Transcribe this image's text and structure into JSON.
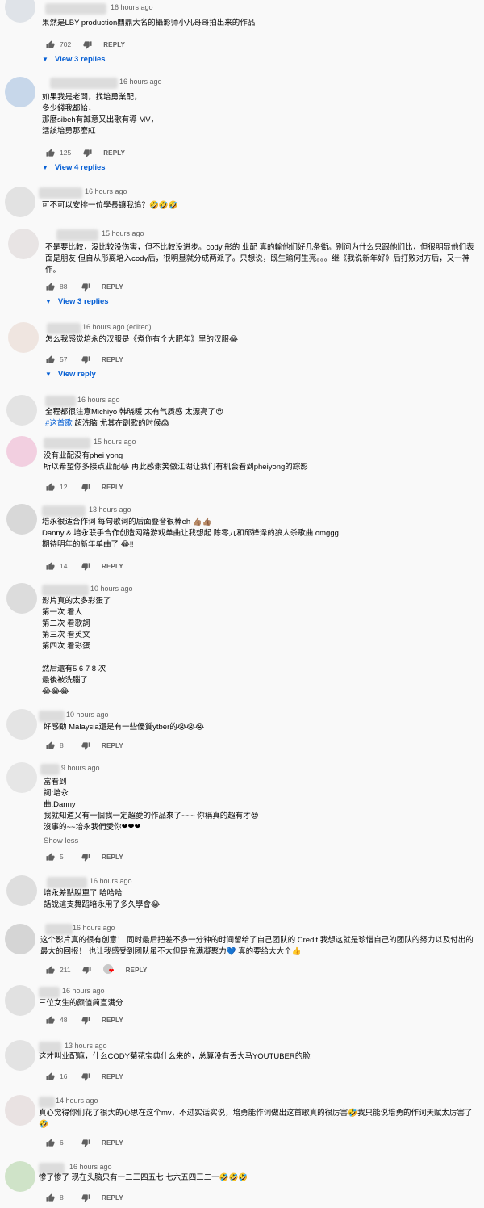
{
  "ui": {
    "reply_label": "REPLY",
    "like_icon": "thumbs-up-icon",
    "dislike_icon": "thumbs-down-icon",
    "expand_icon": "caret-down-icon"
  },
  "comments": [
    {
      "time": "16 hours ago",
      "lines": [
        "果然是LBY production鼎鼎大名的攝影师小凡哥哥拍出来的作品"
      ],
      "likes": "702",
      "replies_label": "View 3 replies",
      "avatar_color": "#dfe3e8"
    },
    {
      "time": "16 hours ago",
      "lines": [
        "如果我是老闆，找培勇業配，",
        "多少錢我都給，",
        "那麼sibeh有誠意又出歌有導 MV，",
        "活該培勇那麼紅"
      ],
      "likes": "125",
      "replies_label": "View 4 replies",
      "avatar_color": "#c7d7ea"
    },
    {
      "time": "16 hours ago",
      "lines": [
        "可不可以安排一位學長讓我追？🤣🤣🤣"
      ],
      "avatar_color": "#e2e2e2"
    },
    {
      "time": "15 hours ago",
      "lines": [
        "不是要比較，没比较没伤害，但不比較没进步。cody 彤的 业配 真的輸他们好几条街。别问为什么只跟他们比，但很明显他们表面是朋友 但自从彤离培入cody后，很明显就分成两派了。只想说，既生瑜何生亮。。。继《我说新年好》后打败对方后，又一神作。"
      ],
      "likes": "88",
      "replies_label": "View 3 replies",
      "avatar_color": "#e8e4e4"
    },
    {
      "time": "16 hours ago (edited)",
      "lines": [
        "怎么我感觉培永的汉服是《煮你有个大肥年》里的汉服😂"
      ],
      "likes": "57",
      "replies_label": "View reply",
      "avatar_color": "#efe5e0"
    },
    {
      "time": "16 hours ago",
      "lines": [
        "全程都很注意Michiyo 韩晓暖 太有气质感 太漂亮了😍"
      ],
      "tag_line": {
        "tag": "#这首歌",
        "rest": " 超洗脑 尤其在副歌的时候😱"
      },
      "avatar_color": "#e3e3e3"
    },
    {
      "time": "15 hours ago",
      "lines": [
        "没有业配没有phei yong",
        "所以希望你多接点业配😂 再此感谢笑傲江湖让我们有机会看到pheiyong的踪影"
      ],
      "likes": "12",
      "avatar_color": "#f2cfe0"
    },
    {
      "time": "13 hours ago",
      "lines": [
        "培永很适合作词 每句歌词的后面叠音很棒eh 👍🏽👍🏽",
        "Danny & 培永联手合作创造网路游戏单曲让我想起 陈零九和邱锋泽的狼人杀歌曲 omggg",
        "期待明年的新年单曲了 😂‼"
      ],
      "likes": "14",
      "avatar_color": "#d8d8d8"
    },
    {
      "time": "10 hours ago",
      "lines": [
        "影片真的太多彩蛋了",
        "第一次 看人",
        "第二次 看歌詞",
        "第三次 看英文",
        "第四次 看彩蛋",
        "",
        "然后還有5 6 7 8 次",
        "最後被洗腦了",
        "😂😂😂"
      ],
      "avatar_color": "#dcdcdc"
    },
    {
      "time": "10 hours ago",
      "lines": [
        "好感動 Malaysia還是有一些優質ytber的😭😭😭"
      ],
      "likes": "8",
      "avatar_color": "#e4e4e4"
    },
    {
      "time": "9 hours ago",
      "lines": [
        "富看到",
        "詞:培永",
        "曲:Danny",
        "我就知道又有一個我一定超愛的作品來了~~~ 你稱真的超有才😍",
        "沒事的~~培永我們愛你❤❤❤"
      ],
      "show_less": "Show less",
      "likes": "5",
      "avatar_color": "#e6e6e6"
    },
    {
      "time": "16 hours ago",
      "lines": [
        "培永差點脫單了 哈哈哈",
        "話說這支舞蹈培永用了多久學會😂"
      ],
      "avatar_color": "#dedede"
    },
    {
      "time": "16 hours ago",
      "lines": [
        "这个影片真的很有创意！ 同时最后把差不多一分钟的时间留给了自己团队的 Credit 我想这就是珍惜自己的团队的努力以及付出的最大的回报！ 也让我感受到团队虽不大但是充满凝聚力💙 真的要给大大个👍"
      ],
      "likes": "211",
      "hearted": true,
      "avatar_color": "#d5d5d5"
    },
    {
      "time": "16 hours ago",
      "lines": [
        "三位女生的颜值简直满分"
      ],
      "likes": "48",
      "avatar_color": "#e1e1e1"
    },
    {
      "time": "13 hours ago",
      "lines": [
        "这才叫业配嘛，什么CODY菊花宝典什么来的，总算没有丢大马YOUTUBER的脸"
      ],
      "likes": "16",
      "avatar_color": "#e3e3e3"
    },
    {
      "time": "14 hours ago",
      "lines": [
        "真心觉得你们花了很大的心思在这个mv，不过实话实说，培勇能作词做出这首歌真的很厉害🤣我只能说培勇的作词天赋太厉害了🤣"
      ],
      "likes": "6",
      "avatar_color": "#e9e2e2"
    },
    {
      "time": "16 hours ago",
      "lines": [
        "惨了惨了 现在头脑只有一二三四五七 七六五四三二一🤣🤣🤣"
      ],
      "likes": "8",
      "avatar_color": "#cfe3c8"
    }
  ]
}
